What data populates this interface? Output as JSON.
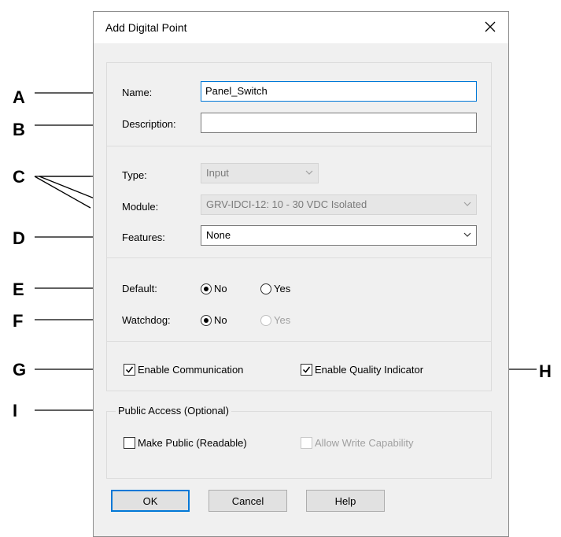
{
  "dialog": {
    "title": "Add Digital Point",
    "close_glyph": "✕",
    "name_label": "Name:",
    "name_value": "Panel_Switch",
    "description_label": "Description:",
    "description_value": "",
    "type_label": "Type:",
    "type_value": "Input",
    "module_label": "Module:",
    "module_value": "GRV-IDCI-12: 10 - 30 VDC Isolated",
    "features_label": "Features:",
    "features_value": "None",
    "default_label": "Default:",
    "default_no": "No",
    "default_yes": "Yes",
    "watchdog_label": "Watchdog:",
    "watchdog_no": "No",
    "watchdog_yes": "Yes",
    "enable_communication": "Enable Communication",
    "enable_quality_indicator": "Enable Quality Indicator",
    "public_access_title": "Public Access (Optional)",
    "make_public": "Make Public (Readable)",
    "allow_write": "Allow Write Capability",
    "ok": "OK",
    "cancel": "Cancel",
    "help": "Help"
  },
  "annotations": [
    "A",
    "B",
    "C",
    "D",
    "E",
    "F",
    "G",
    "H",
    "I"
  ],
  "state": {
    "default_selected": "No",
    "watchdog_selected": "No",
    "enable_communication_checked": true,
    "enable_quality_indicator_checked": true,
    "make_public_checked": false,
    "allow_write_checked": false
  },
  "colors": {
    "focus_border": "#0078d7",
    "dialog_bg": "#f0f0f0"
  }
}
